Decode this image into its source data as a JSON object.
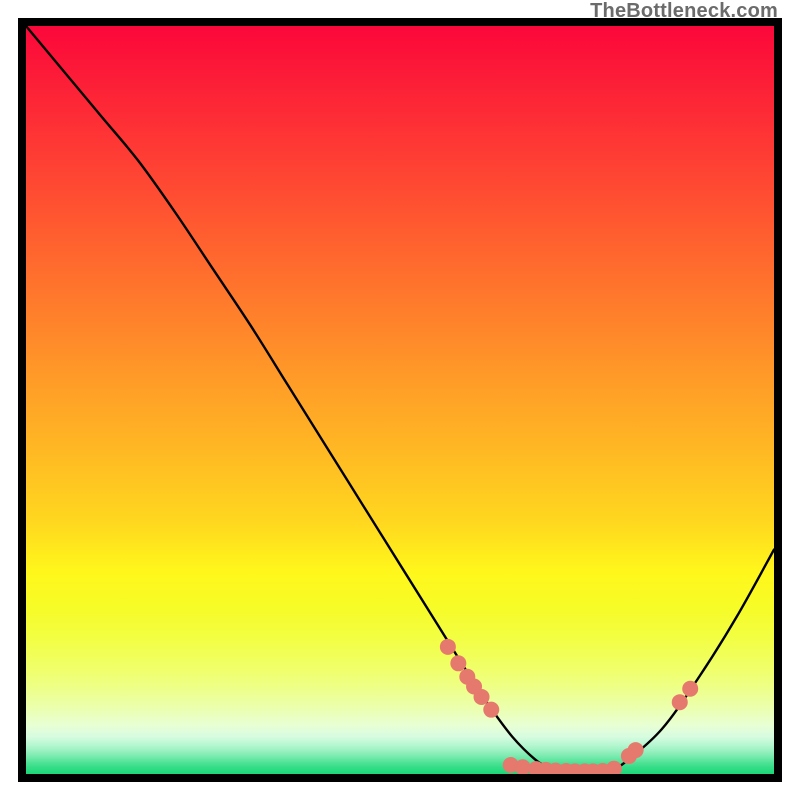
{
  "watermark": "TheBottleneck.com",
  "chart_data": {
    "type": "line",
    "title": "",
    "xlabel": "",
    "ylabel": "",
    "xlim": [
      0,
      100
    ],
    "ylim": [
      0,
      100
    ],
    "x": [
      0,
      5,
      10,
      15,
      20,
      25,
      30,
      35,
      40,
      45,
      50,
      55,
      60,
      62,
      65,
      68,
      70,
      72,
      74,
      76,
      78,
      80,
      85,
      90,
      95,
      100
    ],
    "values": [
      100,
      94,
      88,
      82,
      75,
      67.5,
      60,
      52,
      44,
      36,
      28,
      20,
      12,
      9,
      5,
      2,
      0.8,
      0.4,
      0.2,
      0.2,
      0.5,
      1.5,
      6,
      13,
      21,
      30
    ],
    "gradient_stops": [
      {
        "pos": 0.0,
        "color": "#fb073a"
      },
      {
        "pos": 0.11,
        "color": "#fd2936"
      },
      {
        "pos": 0.22,
        "color": "#ff4b32"
      },
      {
        "pos": 0.33,
        "color": "#ff6e2d"
      },
      {
        "pos": 0.44,
        "color": "#ff9129"
      },
      {
        "pos": 0.55,
        "color": "#ffb324"
      },
      {
        "pos": 0.66,
        "color": "#ffd61f"
      },
      {
        "pos": 0.73,
        "color": "#fff71b"
      },
      {
        "pos": 0.78,
        "color": "#f6fc28"
      },
      {
        "pos": 0.82,
        "color": "#f2fe44"
      },
      {
        "pos": 0.86,
        "color": "#f0ff6a"
      },
      {
        "pos": 0.89,
        "color": "#edff8e"
      },
      {
        "pos": 0.915,
        "color": "#ebffb3"
      },
      {
        "pos": 0.935,
        "color": "#e8ffd4"
      },
      {
        "pos": 0.95,
        "color": "#d7fce0"
      },
      {
        "pos": 0.962,
        "color": "#b4f6cf"
      },
      {
        "pos": 0.972,
        "color": "#8deeb9"
      },
      {
        "pos": 0.98,
        "color": "#67e7a4"
      },
      {
        "pos": 0.986,
        "color": "#4ae193"
      },
      {
        "pos": 0.992,
        "color": "#32dc85"
      },
      {
        "pos": 1.0,
        "color": "#1bd878"
      }
    ],
    "markers": [
      {
        "x": 56.4,
        "y": 17.0
      },
      {
        "x": 57.8,
        "y": 14.8
      },
      {
        "x": 59.0,
        "y": 13.0
      },
      {
        "x": 59.9,
        "y": 11.7
      },
      {
        "x": 60.9,
        "y": 10.3
      },
      {
        "x": 62.2,
        "y": 8.6
      },
      {
        "x": 64.8,
        "y": 1.2
      },
      {
        "x": 66.4,
        "y": 0.9
      },
      {
        "x": 68.2,
        "y": 0.65
      },
      {
        "x": 69.5,
        "y": 0.55
      },
      {
        "x": 70.8,
        "y": 0.45
      },
      {
        "x": 72.2,
        "y": 0.4
      },
      {
        "x": 73.4,
        "y": 0.35
      },
      {
        "x": 74.7,
        "y": 0.35
      },
      {
        "x": 75.8,
        "y": 0.35
      },
      {
        "x": 77.1,
        "y": 0.4
      },
      {
        "x": 78.6,
        "y": 0.7
      },
      {
        "x": 80.6,
        "y": 2.4
      },
      {
        "x": 81.5,
        "y": 3.2
      },
      {
        "x": 87.4,
        "y": 9.6
      },
      {
        "x": 88.8,
        "y": 11.4
      }
    ],
    "marker_color": "#e5796e",
    "marker_radius": 8
  }
}
